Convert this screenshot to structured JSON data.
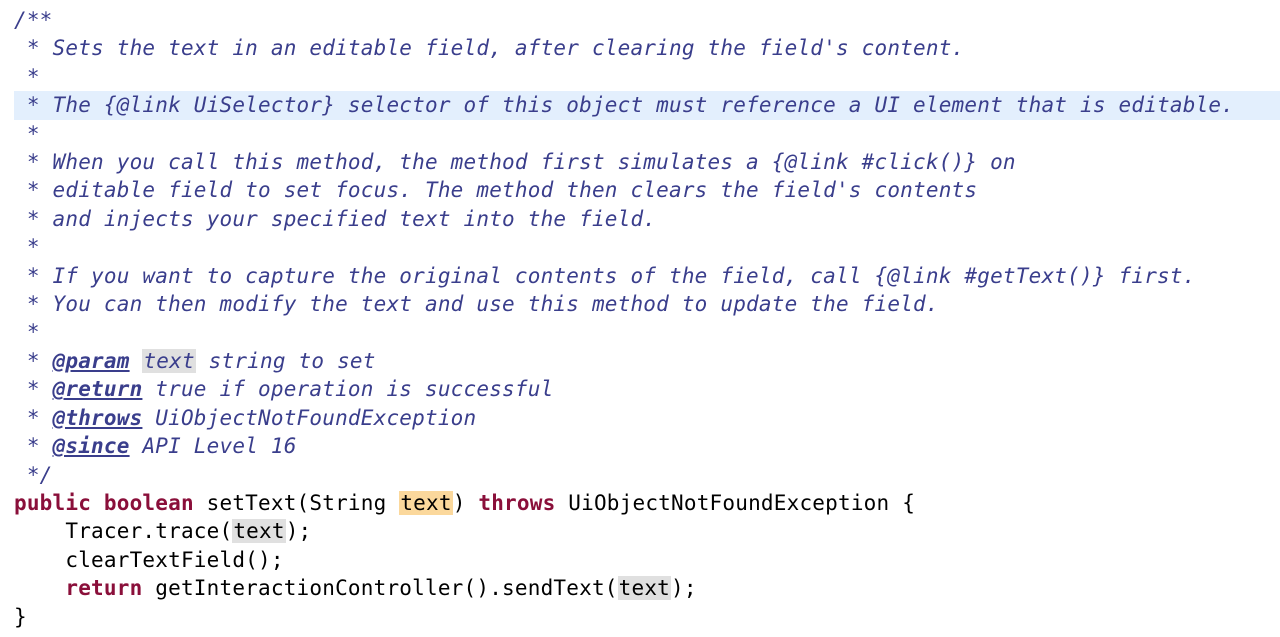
{
  "doc": {
    "l00": "/**",
    "l01_prefix": " * ",
    "l01_text": "Sets the text in an editable field, after clearing the field's content.",
    "l02": " *",
    "l03_prefix": " * ",
    "l03_text": "The {@link UiSelector} selector of this object must reference a UI element that is editable.",
    "l04": " *",
    "l05_prefix": " * ",
    "l05_text": "When you call this method, the method first simulates a {@link #click()} on",
    "l06_prefix": " * ",
    "l06_text": "editable field to set focus. The method then clears the field's contents",
    "l07_prefix": " * ",
    "l07_text": "and injects your specified text into the field.",
    "l08": " *",
    "l09_prefix": " * ",
    "l09_text": "If you want to capture the original contents of the field, call {@link #getText()} first.",
    "l10_prefix": " * ",
    "l10_text": "You can then modify the text and use this method to update the field.",
    "l11": " *",
    "l12_prefix": " * ",
    "l12_tag": "@param",
    "l12_sp1": " ",
    "l12_name": "text",
    "l12_sp2": " ",
    "l12_desc": "string to set",
    "l13_prefix": " * ",
    "l13_tag": "@return",
    "l13_sp": " ",
    "l13_desc": "true if operation is successful",
    "l14_prefix": " * ",
    "l14_tag": "@throws",
    "l14_sp": " ",
    "l14_exc": "UiObjectNotFoundException",
    "l15_prefix": " * ",
    "l15_tag": "@since",
    "l15_sp": " ",
    "l15_desc": "API Level 16",
    "l16": " */"
  },
  "code": {
    "l17_kw1": "public",
    "l17_sp1": " ",
    "l17_kw2": "boolean",
    "l17_sp2": " ",
    "l17_a": "setText(String ",
    "l17_param": "text",
    "l17_b": ") ",
    "l17_kw3": "throws",
    "l17_c": " UiObjectNotFoundException {",
    "l18_a": "    Tracer.trace(",
    "l18_b": "text",
    "l18_c": ");",
    "l19": "    clearTextField();",
    "l20_a": "    ",
    "l20_kw": "return",
    "l20_b": " getInteractionController().sendText(",
    "l20_c": "text",
    "l20_d": ");",
    "l21": "}"
  }
}
